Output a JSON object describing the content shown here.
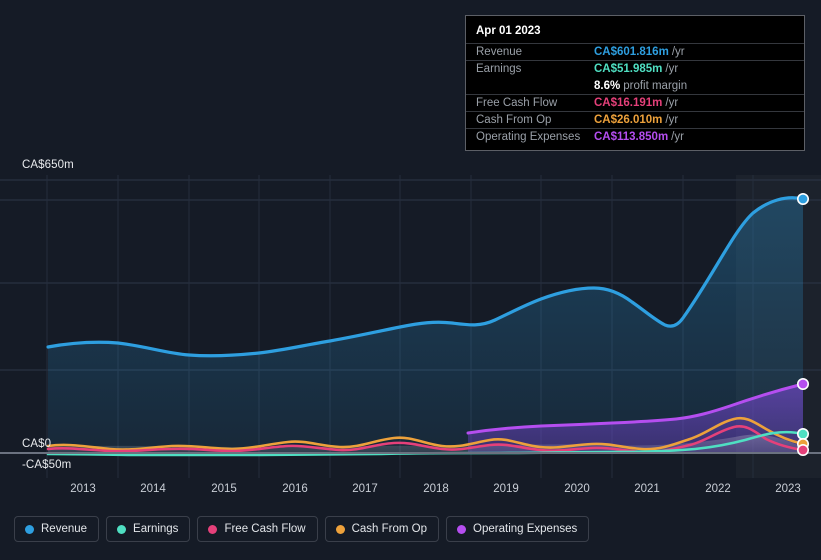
{
  "background_color": "#151b26",
  "axes": {
    "y_top_label": "CA$650m",
    "y_zero_label": "CA$0",
    "y_bottom_label": "-CA$50m",
    "x_ticks": [
      "2013",
      "2014",
      "2015",
      "2016",
      "2017",
      "2018",
      "2019",
      "2020",
      "2021",
      "2022",
      "2023"
    ]
  },
  "tooltip": {
    "date": "Apr 01 2023",
    "rows": [
      {
        "label": "Revenue",
        "value": "CA$601.816m",
        "unit": "/yr",
        "color": "#2e9fe0"
      },
      {
        "label": "Earnings",
        "value": "CA$51.985m",
        "unit": "/yr",
        "color": "#4fdfc2"
      },
      {
        "label": "",
        "value": "8.6%",
        "unit": "profit margin",
        "color": "#ffffff"
      },
      {
        "label": "Free Cash Flow",
        "value": "CA$16.191m",
        "unit": "/yr",
        "color": "#e5407a"
      },
      {
        "label": "Cash From Op",
        "value": "CA$26.010m",
        "unit": "/yr",
        "color": "#eda13b"
      },
      {
        "label": "Operating Expenses",
        "value": "CA$113.850m",
        "unit": "/yr",
        "color": "#b54ef0"
      }
    ]
  },
  "legend": [
    {
      "label": "Revenue",
      "color": "#2e9fe0"
    },
    {
      "label": "Earnings",
      "color": "#4fdfc2"
    },
    {
      "label": "Free Cash Flow",
      "color": "#e5407a"
    },
    {
      "label": "Cash From Op",
      "color": "#eda13b"
    },
    {
      "label": "Operating Expenses",
      "color": "#b54ef0"
    }
  ],
  "chart_data": {
    "type": "area",
    "title": "",
    "xlabel": "",
    "ylabel": "",
    "currency": "CA$",
    "units": "millions",
    "ylim": [
      -50,
      650
    ],
    "y_gridlines": [
      650,
      500,
      350,
      200,
      0,
      -50
    ],
    "grid": true,
    "legend_position": "bottom-left",
    "x_axis_type": "year",
    "x_range": [
      "2012.4",
      "2023.3"
    ],
    "x": [
      2012.4,
      2013,
      2013.5,
      2014,
      2014.5,
      2015,
      2015.5,
      2016,
      2016.5,
      2017,
      2017.5,
      2018,
      2018.5,
      2019,
      2019.5,
      2020,
      2020.5,
      2021,
      2021.5,
      2022,
      2022.5,
      2023,
      2023.3
    ],
    "forecast_boundary_x": 2022.3,
    "series": [
      {
        "name": "Revenue",
        "color": "#2e9fe0",
        "fill": true,
        "values": [
          250,
          258,
          252,
          242,
          238,
          240,
          248,
          252,
          262,
          272,
          278,
          290,
          298,
          320,
          352,
          372,
          368,
          340,
          352,
          400,
          480,
          570,
          601.816
        ],
        "last_value": 601.816,
        "last_marker": true
      },
      {
        "name": "Operating Expenses",
        "color": "#b54ef0",
        "fill": true,
        "start_x": 2018.6,
        "values": [
          null,
          null,
          null,
          null,
          null,
          null,
          null,
          null,
          null,
          null,
          null,
          null,
          48,
          52,
          56,
          60,
          62,
          64,
          70,
          82,
          95,
          108,
          113.85
        ],
        "last_value": 113.85,
        "last_marker": true
      },
      {
        "name": "Cash From Op",
        "color": "#eda13b",
        "fill": false,
        "values": [
          10,
          12,
          8,
          6,
          10,
          14,
          9,
          12,
          16,
          10,
          8,
          14,
          10,
          18,
          14,
          22,
          16,
          12,
          18,
          34,
          44,
          30,
          26.01
        ],
        "last_value": 26.01,
        "last_marker": true
      },
      {
        "name": "Free Cash Flow",
        "color": "#e5407a",
        "fill": false,
        "values": [
          4,
          6,
          2,
          1,
          4,
          8,
          3,
          6,
          10,
          4,
          2,
          8,
          4,
          12,
          8,
          16,
          10,
          6,
          12,
          26,
          36,
          22,
          16.191
        ],
        "last_value": 16.191,
        "last_marker": true
      },
      {
        "name": "Earnings",
        "color": "#4fdfc2",
        "fill": false,
        "values": [
          -6,
          -5,
          -4,
          -5,
          -4,
          -3,
          -4,
          -3,
          -2,
          -3,
          -4,
          -2,
          -2,
          0,
          1,
          2,
          1,
          0,
          2,
          10,
          20,
          40,
          51.985
        ],
        "last_value": 51.985,
        "last_marker": true
      }
    ]
  }
}
